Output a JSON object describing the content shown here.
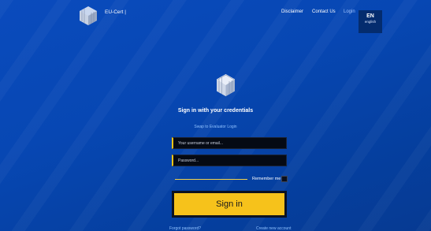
{
  "header": {
    "brand": "EU-Cert |",
    "nav": {
      "disclaimer": "Disclaimer",
      "contact": "Contact Us",
      "login": "Login"
    },
    "language": {
      "code": "EN",
      "name": "english"
    }
  },
  "login": {
    "title": "Sign in with your credentials",
    "swap_link": "Swap to Evaluator Login",
    "username_placeholder": "Your username or email...",
    "password_placeholder": "Password...",
    "remember_label": "Remember me",
    "signin_label": "Sign in",
    "forgot_link": "Forgot password?",
    "create_link": "Create new account"
  },
  "colors": {
    "background": "#0747b3",
    "accent": "#f6c21b",
    "link": "#8ec0ff",
    "field_bg": "#050a14"
  },
  "icons": {
    "logo": "cube-logo-icon"
  }
}
